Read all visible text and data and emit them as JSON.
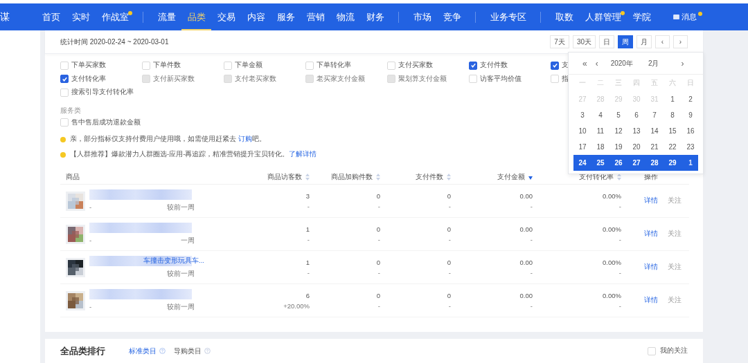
{
  "nav": {
    "logo_fragment": "谋",
    "groups": [
      [
        {
          "label": "首页",
          "selected": false,
          "badge": false
        },
        {
          "label": "实时",
          "selected": false,
          "badge": false
        },
        {
          "label": "作战室",
          "selected": false,
          "badge": true
        }
      ],
      [
        {
          "label": "流量",
          "selected": false,
          "badge": false
        },
        {
          "label": "品类",
          "selected": true,
          "badge": false
        },
        {
          "label": "交易",
          "selected": false,
          "badge": false
        },
        {
          "label": "内容",
          "selected": false,
          "badge": false
        },
        {
          "label": "服务",
          "selected": false,
          "badge": false
        },
        {
          "label": "营销",
          "selected": false,
          "badge": false
        },
        {
          "label": "物流",
          "selected": false,
          "badge": false
        },
        {
          "label": "财务",
          "selected": false,
          "badge": false
        }
      ],
      [
        {
          "label": "市场",
          "selected": false,
          "badge": false
        },
        {
          "label": "竞争",
          "selected": false,
          "badge": false
        }
      ],
      [
        {
          "label": "业务专区",
          "selected": false,
          "badge": false
        }
      ],
      [
        {
          "label": "取数",
          "selected": false,
          "badge": false
        },
        {
          "label": "人群管理",
          "selected": false,
          "badge": true
        },
        {
          "label": "学院",
          "selected": false,
          "badge": false
        }
      ]
    ],
    "message": {
      "label": "消息",
      "badge": true
    }
  },
  "stats": {
    "period": "统计时间 2020-02-24 ~ 2020-03-01",
    "ranges": [
      {
        "label": "7天",
        "selected": false
      },
      {
        "label": "30天",
        "selected": false
      },
      {
        "label": "日",
        "selected": false
      },
      {
        "label": "周",
        "selected": true
      },
      {
        "label": "月",
        "selected": false
      }
    ],
    "prev": "‹",
    "next": "›"
  },
  "metric_rows": [
    [
      {
        "label": "下单买家数",
        "checked": false,
        "disabled": false
      },
      {
        "label": "下单件数",
        "checked": false,
        "disabled": false
      },
      {
        "label": "下单金额",
        "checked": false,
        "disabled": false
      },
      {
        "label": "下单转化率",
        "checked": false,
        "disabled": false
      },
      {
        "label": "支付买家数",
        "checked": false,
        "disabled": false
      },
      {
        "label": "支付件数",
        "checked": true,
        "disabled": false
      },
      {
        "label": "支",
        "checked": true,
        "disabled": false
      }
    ],
    [
      {
        "label": "支付转化率",
        "checked": true,
        "disabled": false
      },
      {
        "label": "支付新买家数",
        "checked": false,
        "disabled": true
      },
      {
        "label": "支付老买家数",
        "checked": false,
        "disabled": true
      },
      {
        "label": "老买家支付金额",
        "checked": false,
        "disabled": true
      },
      {
        "label": "聚划算支付金额",
        "checked": false,
        "disabled": true
      },
      {
        "label": "访客平均价值",
        "checked": false,
        "disabled": false
      },
      {
        "label": "指",
        "checked": false,
        "disabled": false
      }
    ],
    [
      {
        "label": "搜索引导支付转化率",
        "checked": false,
        "disabled": false
      }
    ]
  ],
  "service": {
    "heading": "服务类",
    "metrics": [
      {
        "label": "售中售后成功退款金额",
        "checked": false,
        "disabled": false
      }
    ]
  },
  "notices": [
    {
      "text": "亲，部分指标仅支持付费用户使用哦，如需使用赶紧去 ",
      "link": "订购",
      "suffix": "吧。"
    },
    {
      "text": "【人群推荐】爆款潜力人群圈选-应用-再追踪，精准营销提升宝贝转化。",
      "link": "了解详情"
    }
  ],
  "calendar": {
    "prev_year": "«",
    "prev_month": "‹",
    "year": "2020年",
    "month": "2月",
    "next_month": "›",
    "weekdays": [
      "一",
      "二",
      "三",
      "四",
      "五",
      "六",
      "日"
    ],
    "weeks": [
      {
        "selected": false,
        "days": [
          {
            "label": "27",
            "outside": true
          },
          {
            "label": "28",
            "outside": true
          },
          {
            "label": "29",
            "outside": true
          },
          {
            "label": "30",
            "outside": true
          },
          {
            "label": "31",
            "outside": true
          },
          {
            "label": "1",
            "outside": false
          },
          {
            "label": "2",
            "outside": false
          }
        ]
      },
      {
        "selected": false,
        "days": [
          {
            "label": "3",
            "outside": false
          },
          {
            "label": "4",
            "outside": false
          },
          {
            "label": "5",
            "outside": false
          },
          {
            "label": "6",
            "outside": false
          },
          {
            "label": "7",
            "outside": false
          },
          {
            "label": "8",
            "outside": false
          },
          {
            "label": "9",
            "outside": false
          }
        ]
      },
      {
        "selected": false,
        "days": [
          {
            "label": "10",
            "outside": false
          },
          {
            "label": "11",
            "outside": false
          },
          {
            "label": "12",
            "outside": false
          },
          {
            "label": "13",
            "outside": false
          },
          {
            "label": "14",
            "outside": false
          },
          {
            "label": "15",
            "outside": false
          },
          {
            "label": "16",
            "outside": false
          }
        ]
      },
      {
        "selected": false,
        "days": [
          {
            "label": "17",
            "outside": false
          },
          {
            "label": "18",
            "outside": false
          },
          {
            "label": "19",
            "outside": false
          },
          {
            "label": "20",
            "outside": false
          },
          {
            "label": "21",
            "outside": false
          },
          {
            "label": "22",
            "outside": false
          },
          {
            "label": "23",
            "outside": false
          }
        ]
      },
      {
        "selected": true,
        "days": [
          {
            "label": "24",
            "outside": false
          },
          {
            "label": "25",
            "outside": false
          },
          {
            "label": "26",
            "outside": false
          },
          {
            "label": "27",
            "outside": false
          },
          {
            "label": "28",
            "outside": false
          },
          {
            "label": "29",
            "outside": false
          },
          {
            "label": "1",
            "outside": true
          }
        ]
      }
    ]
  },
  "table": {
    "columns": [
      {
        "label": "商品",
        "sortable": false
      },
      {
        "label": "商品访客数",
        "sortable": true,
        "descending": false
      },
      {
        "label": "商品加购件数",
        "sortable": true,
        "descending": false
      },
      {
        "label": "支付件数",
        "sortable": true,
        "descending": false
      },
      {
        "label": "支付金额",
        "sortable": true,
        "descending": true
      },
      {
        "label": "支付转化率",
        "sortable": true,
        "descending": false
      },
      {
        "label": "操作",
        "sortable": false
      }
    ],
    "rows": [
      {
        "redacted": true,
        "sub": "-",
        "compare": "较前一周",
        "cells": [
          {
            "value": "3",
            "change": "-"
          },
          {
            "value": "0",
            "change": "-"
          },
          {
            "value": "0",
            "change": "-"
          },
          {
            "value": "0.00",
            "change": "-"
          },
          {
            "value": "0.00%",
            "change": "-"
          }
        ],
        "actions": [
          "详情",
          "关注"
        ]
      },
      {
        "redacted": true,
        "sub": "-",
        "compare": "一周",
        "cells": [
          {
            "value": "1",
            "change": "-"
          },
          {
            "value": "0",
            "change": "-"
          },
          {
            "value": "0",
            "change": "-"
          },
          {
            "value": "0.00",
            "change": "-"
          },
          {
            "value": "0.00%",
            "change": "-"
          }
        ],
        "actions": [
          "详情",
          "关注"
        ]
      },
      {
        "redacted": true,
        "name": "车撞击变形玩具车...",
        "compare": "较前一周",
        "cells": [
          {
            "value": "1",
            "change": "-"
          },
          {
            "value": "0",
            "change": "-"
          },
          {
            "value": "0",
            "change": "-"
          },
          {
            "value": "0.00",
            "change": "-"
          },
          {
            "value": "0.00%",
            "change": "-"
          }
        ],
        "actions": [
          "详情",
          "关注"
        ]
      },
      {
        "redacted": true,
        "sub": "-",
        "compare": "较前一周",
        "cells": [
          {
            "value": "6",
            "change": "+20.00%"
          },
          {
            "value": "0",
            "change": "-"
          },
          {
            "value": "0",
            "change": "-"
          },
          {
            "value": "0.00",
            "change": "-"
          },
          {
            "value": "0.00%",
            "change": "-"
          }
        ],
        "actions": [
          "详情",
          "关注"
        ]
      }
    ]
  },
  "ranking": {
    "title": "全品类排行",
    "tabs": [
      {
        "label": "标准类目",
        "selected": true
      },
      {
        "label": "导购类目",
        "selected": false
      }
    ],
    "filter": {
      "label": "我的关注",
      "checked": false
    }
  }
}
